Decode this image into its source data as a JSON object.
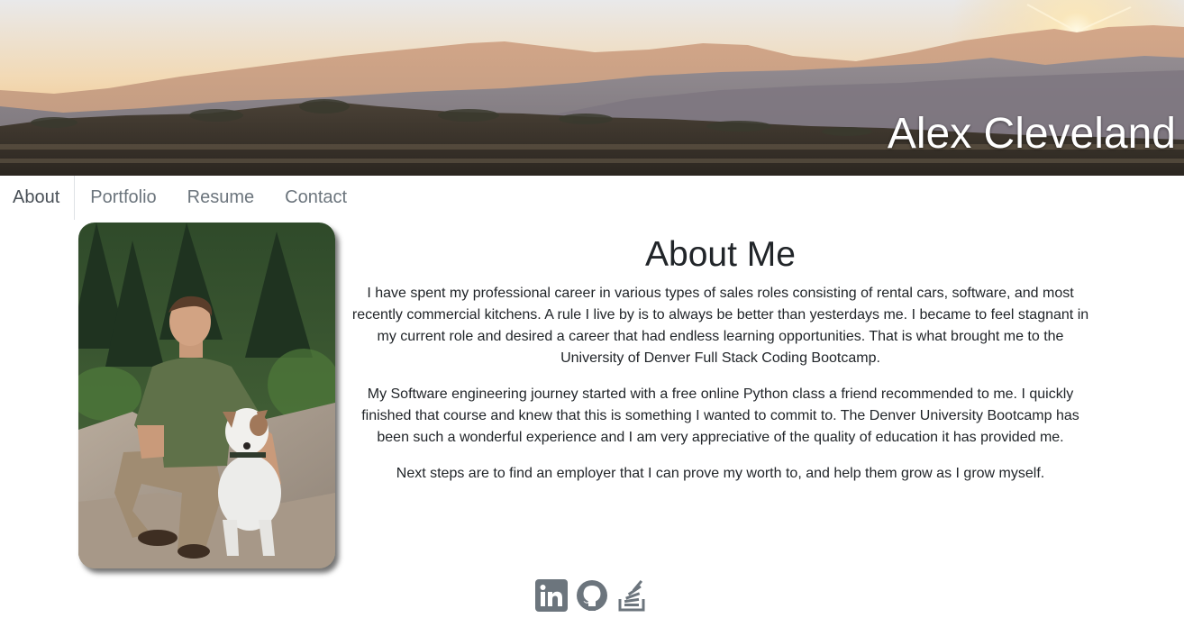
{
  "header": {
    "name": "Alex Cleveland"
  },
  "nav": {
    "items": [
      {
        "label": "About",
        "active": true
      },
      {
        "label": "Portfolio",
        "active": false
      },
      {
        "label": "Resume",
        "active": false
      },
      {
        "label": "Contact",
        "active": false
      }
    ]
  },
  "about": {
    "title": "About Me",
    "paragraphs": [
      "I have spent my professional career in various types of sales roles consisting of rental cars, software, and most recently commercial kitchens. A rule I live by is to always be better than yesterdays me. I became to feel stagnant in my current role and desired a career that had endless learning opportunities. That is what brought me to the University of Denver Full Stack Coding Bootcamp.",
      "My Software engineering journey started with a free online Python class a friend recommended to me. I quickly finished that course and knew that this is something I wanted to commit to. The Denver University Bootcamp has been such a wonderful experience and I am very appreciative of the quality of education it has provided me.",
      "Next steps are to find an employer that I can prove my worth to, and help them grow as I grow myself."
    ]
  },
  "social": {
    "icons": [
      "linkedin-icon",
      "github-icon",
      "stackoverflow-icon"
    ],
    "color": "#6c757d"
  },
  "colors": {
    "nav_active": "#495057",
    "nav_inactive": "#6c757d",
    "text": "#212529"
  }
}
